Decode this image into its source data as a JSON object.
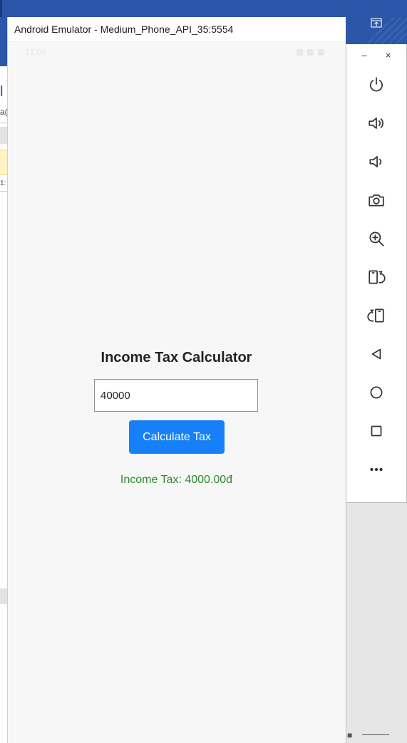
{
  "emulator": {
    "title": "Android Emulator - Medium_Phone_API_35:5554"
  },
  "status_bar": {
    "time": "12:04"
  },
  "app": {
    "title": "Income Tax Calculator",
    "income_value": "40000",
    "calculate_label": "Calculate Tax",
    "result_text": "Income Tax: 4000.00đ"
  },
  "toolbar": {
    "minimize_label": "–",
    "close_label": "×",
    "buttons": [
      {
        "icon": "power-icon"
      },
      {
        "icon": "volume-up-icon"
      },
      {
        "icon": "volume-down-icon"
      },
      {
        "icon": "camera-icon"
      },
      {
        "icon": "zoom-in-icon"
      },
      {
        "icon": "rotate-left-icon"
      },
      {
        "icon": "rotate-right-icon"
      },
      {
        "icon": "back-icon"
      },
      {
        "icon": "home-icon"
      },
      {
        "icon": "overview-icon"
      },
      {
        "icon": "more-icon"
      }
    ]
  },
  "background_window": {
    "fragment_a": "l",
    "fragment_b": "a(",
    "fragment_c": "1:"
  },
  "colors": {
    "accent_blue": "#2c57a8",
    "button_blue": "#1680f8",
    "result_green": "#2a8a2a"
  }
}
